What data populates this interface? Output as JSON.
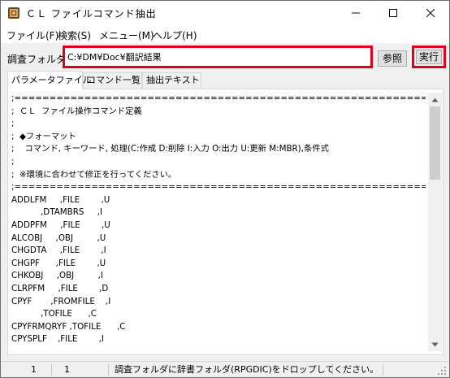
{
  "window": {
    "title": "ＣＬ ファイルコマンド抽出",
    "controls": {
      "minimize": "minimize-icon",
      "maximize": "maximize-icon",
      "close": "close-icon"
    }
  },
  "menu": {
    "items": [
      "ファイル(F)",
      "検索(S)",
      "メニュー(M)",
      "ヘルプ(H)"
    ]
  },
  "folder": {
    "label": "調査フォルダ",
    "value": "C:¥DM¥Doc¥翻訳結果",
    "browse_label": "参照",
    "run_label": "実行"
  },
  "highlight_color": "#e0001b",
  "tabs": [
    "パラメータファイル",
    "コマンド一覧",
    "抽出テキスト"
  ],
  "active_tab": 0,
  "editor": {
    "lines": [
      ";=========================================================================",
      ";  ＣＬ  ファイル操作コマンド定義",
      ";",
      ";  ◆フォーマット",
      ";    コマンド, キーワード, 処理(C:作成 D:削除 I:入力 O:出力 U:更新 M:MBR),条件式",
      ";",
      ";  ※環境に合わせて修正を行ってください。",
      ";=========================================================================",
      "ADDLFM     ,FILE        ,U",
      "           ,DTAMBRS     ,I",
      "ADDPFM     ,FILE        ,U",
      "ALCOBJ     ,OBJ         ,U",
      "CHGDTA     ,FILE        ,I",
      "CHGPF      ,FILE        ,U",
      "CHKOBJ     ,OBJ         ,I",
      "CLRPFM     ,FILE        ,D",
      "CPYF       ,FROMFILE    ,I",
      "           ,TOFILE      ,C",
      "CPYFRMQRYF ,TOFILE      ,C",
      "CPYSPLF    ,FILE        ,I"
    ]
  },
  "status": {
    "line": "1",
    "column": "1",
    "message": "調査フォルダに辞書フォルダ(RPGDIC)をドロップしてください。"
  }
}
